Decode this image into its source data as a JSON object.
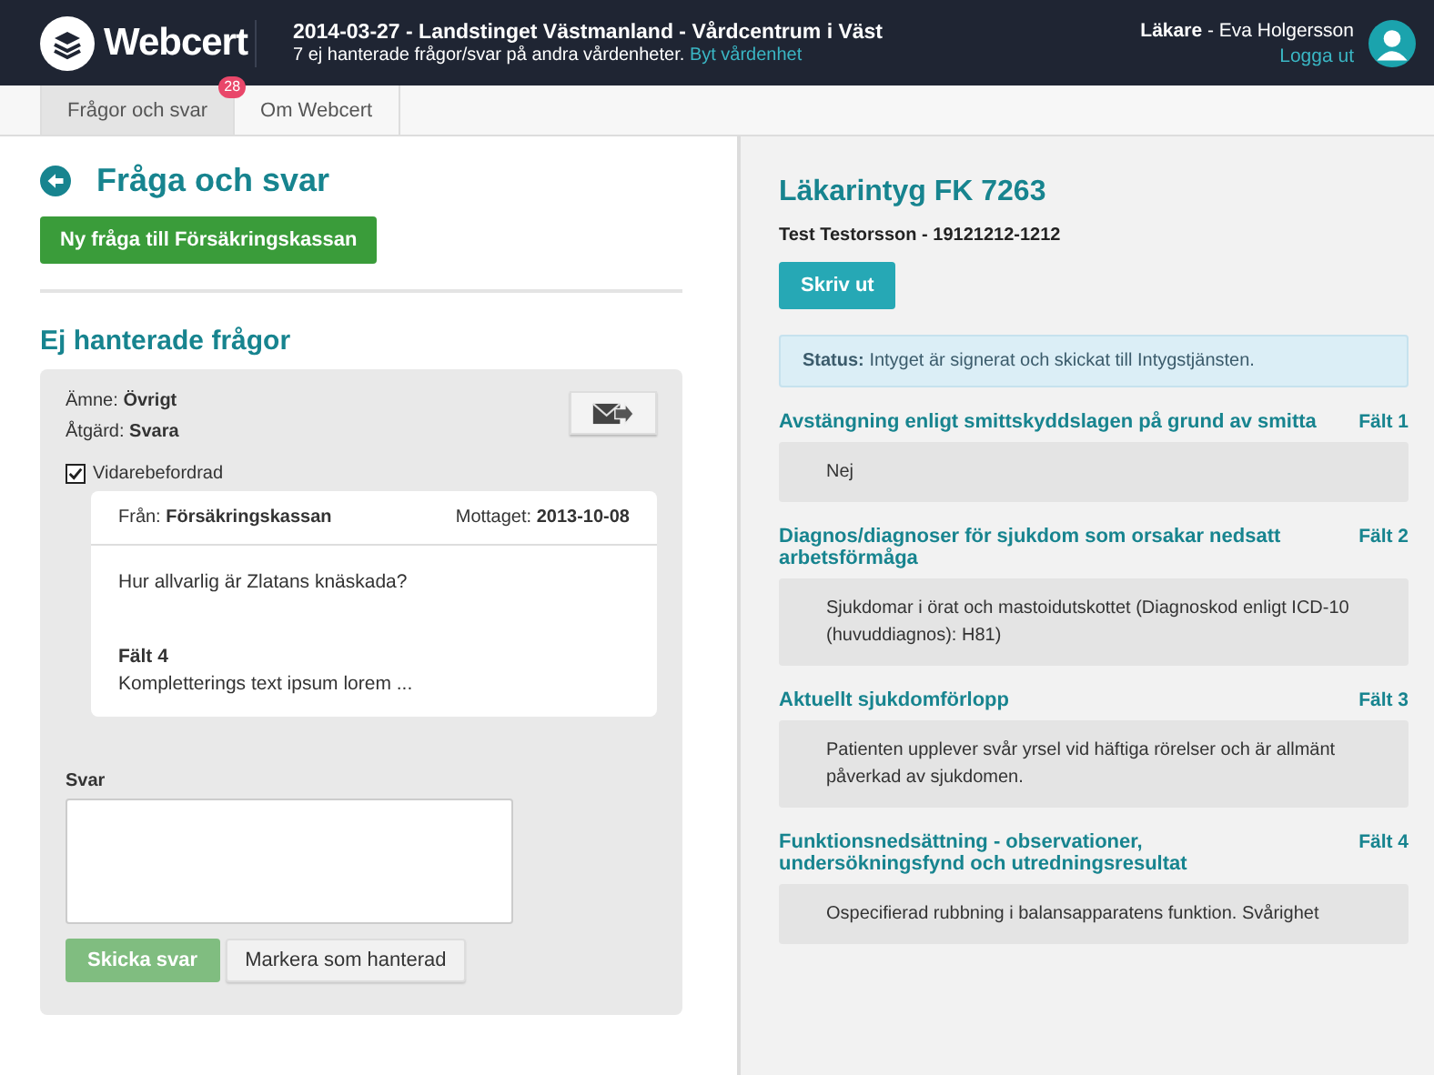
{
  "header": {
    "logo": "Webcert",
    "title": "2014-03-27 - Landstinget Västmanland - Vårdcentrum i Väst",
    "notice": "7 ej hanterade frågor/svar på andra vårdenheter.",
    "switch_link": "Byt vårdenhet",
    "role": "Läkare",
    "user": "- Eva Holgersson",
    "logout": "Logga ut"
  },
  "tabs": [
    {
      "label": "Frågor och svar",
      "selected": true,
      "badge": "28"
    },
    {
      "label": "Om Webcert",
      "selected": false
    }
  ],
  "page_title": "Fråga och svar",
  "new_question_button": "Ny fråga till Försäkringskassan",
  "section_title": "Ej hanterade frågor",
  "question": {
    "subject_label": "Ämne:",
    "subject": "Övrigt",
    "action_label": "Åtgärd:",
    "action": "Svara",
    "forwarded_label": "Vidarebefordrad",
    "forwarded": true,
    "from_label": "Från:",
    "from": "Försäkringskassan",
    "received_label": "Mottaget:",
    "received": "2013-10-08",
    "text": "Hur allvarlig är Zlatans knäskada?",
    "field_label": "Fält 4",
    "field_text": "Kompletterings text ipsum lorem ...",
    "answer_label": "Svar",
    "send_button": "Skicka svar",
    "send_disabled": true,
    "handled_button": "Markera som hanterad"
  },
  "certificate": {
    "title": "Läkarintyg FK 7263",
    "patient": "Test Testorsson - 19121212-1212",
    "print_button": "Skriv ut",
    "status_label": "Status:",
    "status": "Intyget är signerat och skickat till Intygstjänsten.",
    "fields": [
      {
        "heading": "Avstängning enligt smittskyddslagen på grund av smitta",
        "field": "Fält 1",
        "value": "Nej"
      },
      {
        "heading": "Diagnos/diagnoser för sjukdom som orsakar nedsatt arbetsförmåga",
        "field": "Fält 2",
        "value": "Sjukdomar i örat och mastoidutskottet (Diagnoskod enligt ICD-10 (huvuddiagnos): H81)"
      },
      {
        "heading": "Aktuellt sjukdomförlopp",
        "field": "Fält 3",
        "value": "Patienten upplever svår yrsel vid häftiga rörelser och är allmänt påverkad av sjukdomen."
      },
      {
        "heading": "Funktionsnedsättning - observationer, undersökningsfynd och utredningsresultat",
        "field": "Fält 4",
        "value": "Ospecifierad rubbning i balansapparatens funktion. Svårighet"
      }
    ]
  }
}
